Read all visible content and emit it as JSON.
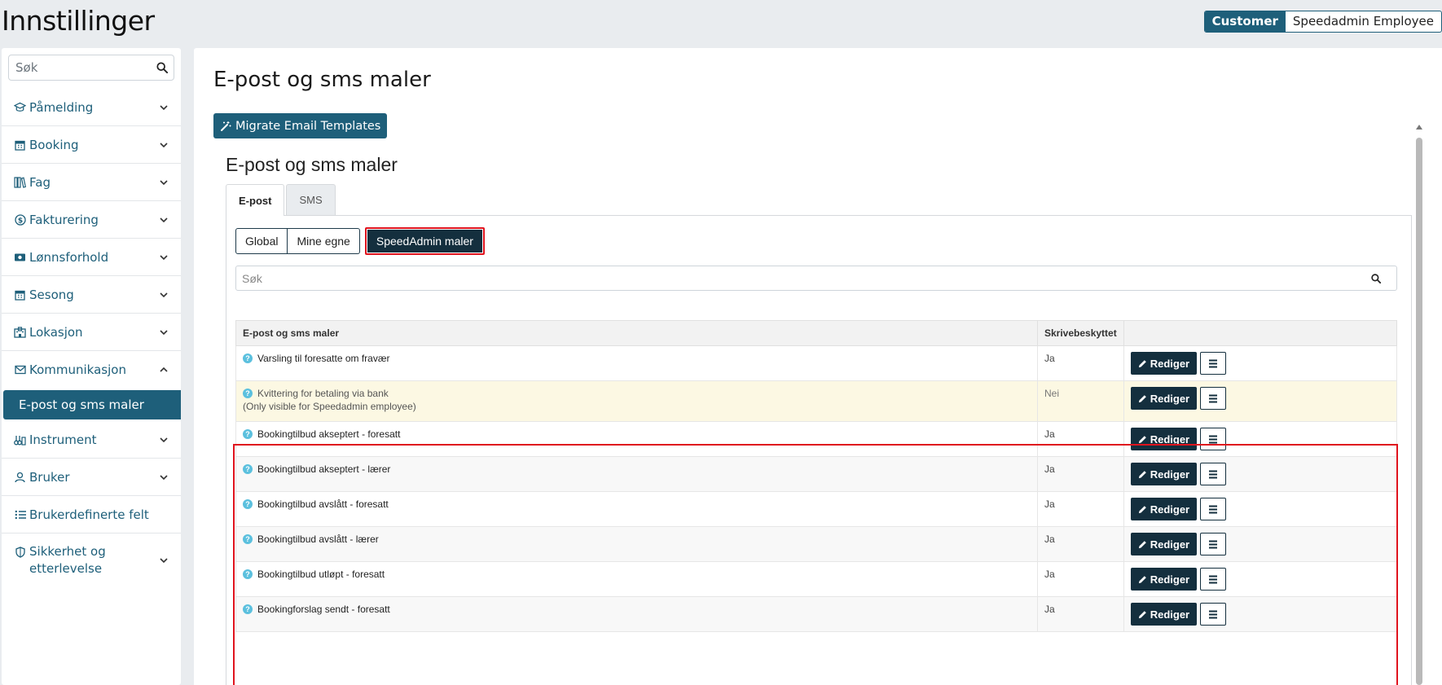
{
  "page": {
    "title": "Innstillinger"
  },
  "role_toggle": {
    "customer": "Customer",
    "employee": "Speedadmin Employee"
  },
  "sidebar": {
    "search_placeholder": "Søk",
    "items": [
      {
        "label": "Påmelding",
        "icon": "graduation-cap-icon"
      },
      {
        "label": "Booking",
        "icon": "calendar-icon"
      },
      {
        "label": "Fag",
        "icon": "books-icon"
      },
      {
        "label": "Fakturering",
        "icon": "dollar-circle-icon"
      },
      {
        "label": "Lønnsforhold",
        "icon": "money-bill-icon"
      },
      {
        "label": "Sesong",
        "icon": "calendar-icon"
      },
      {
        "label": "Lokasjon",
        "icon": "building-icon"
      },
      {
        "label": "Kommunikasjon",
        "icon": "envelope-icon"
      },
      {
        "label": "E-post og sms maler"
      },
      {
        "label": "Instrument",
        "icon": "instrument-icon"
      },
      {
        "label": "Bruker",
        "icon": "user-icon"
      },
      {
        "label": "Brukerdefinerte felt",
        "icon": "list-icon"
      },
      {
        "label": "Sikkerhet og etterlevelse",
        "icon": "shield-icon"
      }
    ]
  },
  "main": {
    "title": "E-post og sms maler",
    "migrate_label": "Migrate Email Templates",
    "panel_title": "E-post og sms maler",
    "tabs": [
      {
        "label": "E-post"
      },
      {
        "label": "SMS"
      }
    ],
    "filters": {
      "global": "Global",
      "mine": "Mine egne",
      "speedadmin": "SpeedAdmin maler"
    },
    "search_placeholder": "Søk",
    "table": {
      "headers": {
        "name": "E-post og sms maler",
        "readonly": "Skrivebeskyttet",
        "actions": ""
      },
      "edit_label": "Rediger",
      "rows": [
        {
          "name": "Varsling til foresatte om fravær",
          "readonly": "Ja"
        },
        {
          "name": "Kvittering for betaling via bank",
          "note": "(Only visible for Speedadmin employee)",
          "readonly": "Nei"
        },
        {
          "name": "Bookingtilbud akseptert - foresatt",
          "readonly": "Ja"
        },
        {
          "name": "Bookingtilbud akseptert - lærer",
          "readonly": "Ja"
        },
        {
          "name": "Bookingtilbud avslått - foresatt",
          "readonly": "Ja"
        },
        {
          "name": "Bookingtilbud avslått - lærer",
          "readonly": "Ja"
        },
        {
          "name": "Bookingtilbud utløpt - foresatt",
          "readonly": "Ja"
        },
        {
          "name": "Bookingforslag sendt - foresatt",
          "readonly": "Ja"
        }
      ]
    }
  },
  "colors": {
    "accent": "#1e5f7a",
    "dark_button": "#142f3e",
    "highlight": "#e0141e",
    "warning_row": "#fcf8e3"
  }
}
